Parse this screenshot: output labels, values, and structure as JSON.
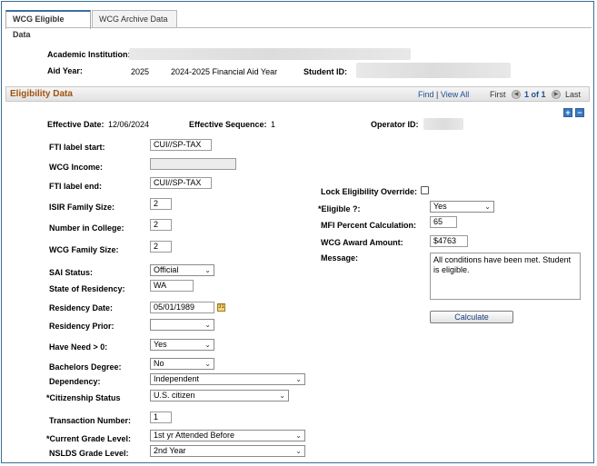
{
  "tabs": [
    {
      "label": "WCG Eligible Data",
      "active": true
    },
    {
      "label": "WCG Archive Data",
      "active": false
    }
  ],
  "header": {
    "academic_institution_label": "Academic Institution:",
    "aid_year_label": "Aid Year:",
    "aid_year_value": "2025",
    "aid_year_desc": "2024-2025 Financial Aid Year",
    "student_id_label": "Student ID:"
  },
  "section": {
    "title": "Eligibility Data",
    "find": "Find",
    "separator": "|",
    "view_all": "View All",
    "first": "First",
    "count": "1 of 1",
    "last": "Last"
  },
  "meta": {
    "effective_date_label": "Effective Date:",
    "effective_date_value": "12/06/2024",
    "effective_seq_label": "Effective Sequence:",
    "effective_seq_value": "1",
    "operator_id_label": "Operator ID:"
  },
  "form": {
    "fti_start_label": "FTI label start:",
    "fti_start_value": "CUI//SP-TAX",
    "wcg_income_label": "WCG Income:",
    "fti_end_label": "FTI label end:",
    "fti_end_value": "CUI//SP-TAX",
    "isir_family_label": "ISIR Family Size:",
    "isir_family_value": "2",
    "num_college_label": "Number in College:",
    "num_college_value": "2",
    "wcg_family_label": "WCG Family Size:",
    "wcg_family_value": "2",
    "sai_status_label": "SAI Status:",
    "sai_status_value": "Official",
    "state_residency_label": "State of Residency:",
    "state_residency_value": "WA",
    "residency_date_label": "Residency Date:",
    "residency_date_value": "05/01/1989",
    "residency_prior_label": "Residency Prior:",
    "residency_prior_value": "",
    "have_need_label": "Have Need > 0:",
    "have_need_value": "Yes",
    "bachelors_label": "Bachelors Degree:",
    "bachelors_value": "No",
    "dependency_label": "Dependency:",
    "dependency_value": "Independent",
    "citizenship_label": "*Citizenship Status",
    "citizenship_value": "U.S. citizen",
    "transaction_label": "Transaction Number:",
    "transaction_value": "1",
    "current_grade_label": "*Current Grade Level:",
    "current_grade_value": "1st yr Attended Before",
    "nslds_grade_label": "NSLDS Grade Level:",
    "nslds_grade_value": "2nd Year"
  },
  "right": {
    "lock_override_label": "Lock Eligibility Override:",
    "eligible_label": "*Eligible ?:",
    "eligible_value": "Yes",
    "mfi_label": "MFI Percent Calculation:",
    "mfi_value": "65",
    "award_label": "WCG Award Amount:",
    "award_value": "$4763",
    "message_label": "Message:",
    "message_value": "All conditions have been met.  Student is eligible.",
    "calculate_label": "Calculate"
  },
  "icons": {
    "add": "+",
    "remove": "−",
    "chevron": "⌄"
  }
}
